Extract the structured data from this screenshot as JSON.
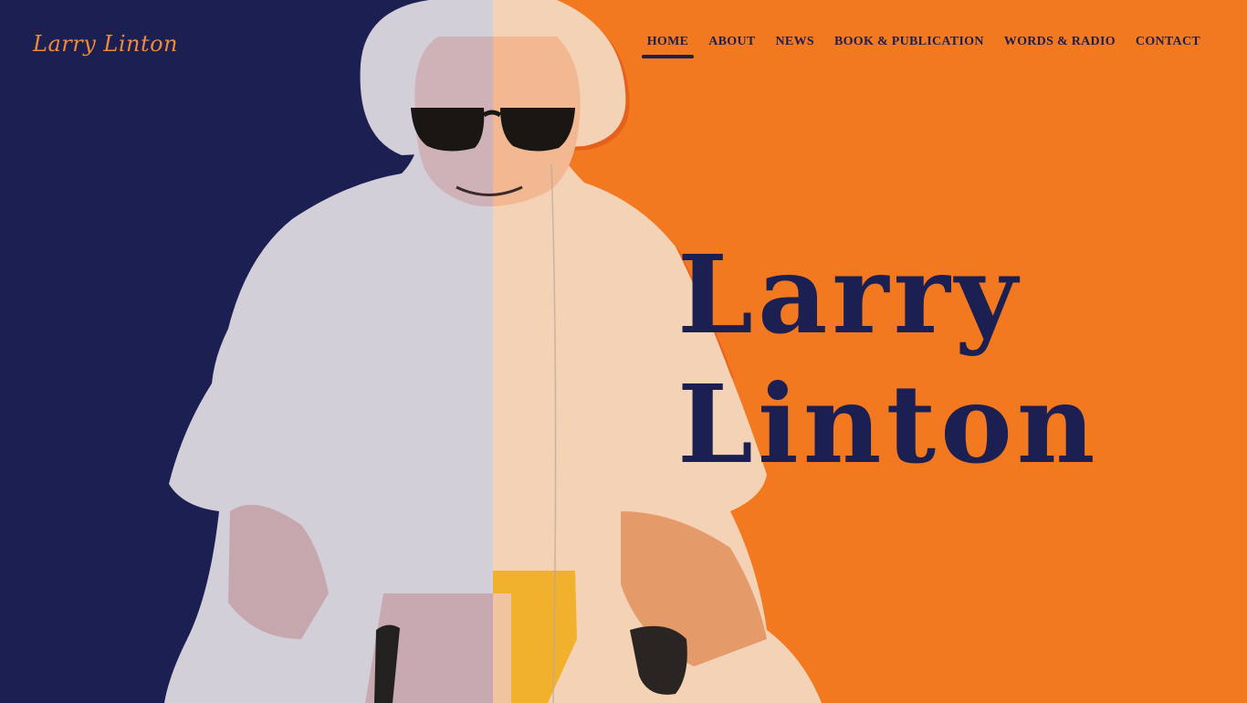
{
  "colors": {
    "navy": "#1b1f52",
    "orange": "#f27920",
    "logo_orange": "#f08a3a",
    "shirt_left": "#d5d1d8",
    "shirt_right": "#f3cfb0"
  },
  "logo": {
    "text": "Larry Linton"
  },
  "nav": {
    "items": [
      {
        "label": "HOME",
        "active": true
      },
      {
        "label": "ABOUT",
        "active": false
      },
      {
        "label": "NEWS",
        "active": false
      },
      {
        "label": "BOOK & PUBLICATION",
        "active": false
      },
      {
        "label": "WORDS & RADIO",
        "active": false
      },
      {
        "label": "CONTACT",
        "active": false
      }
    ]
  },
  "hero": {
    "line1": "Larry",
    "line2": "Linton"
  },
  "portrait": {
    "icon": "person-portrait-photo"
  }
}
